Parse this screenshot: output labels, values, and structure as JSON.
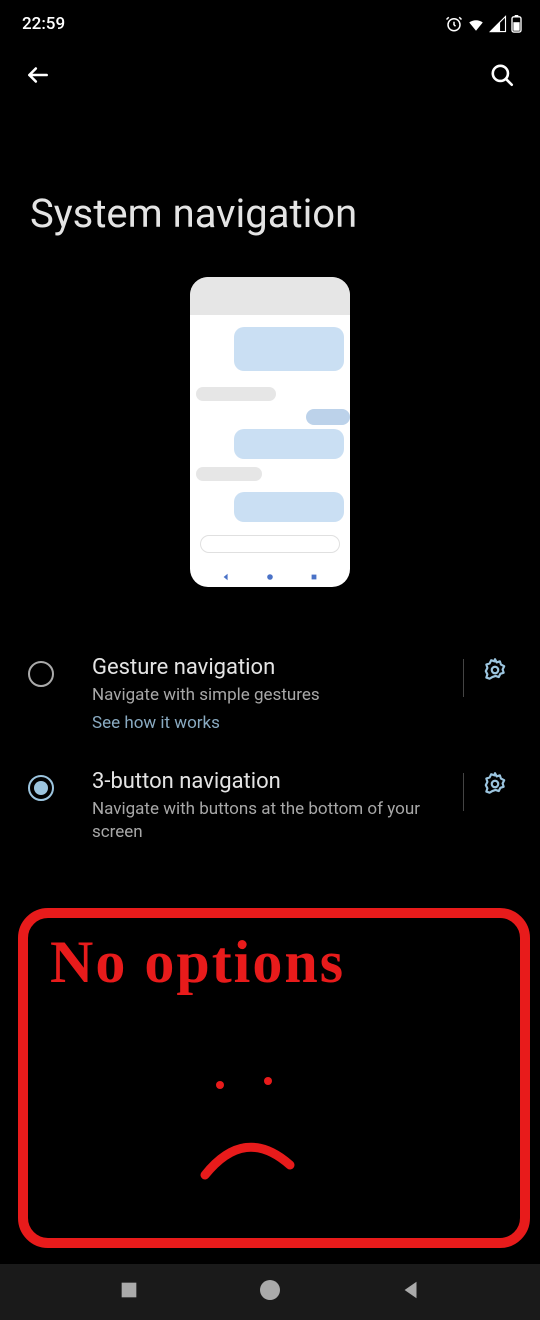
{
  "status": {
    "time": "22:59"
  },
  "header": {
    "title": "System navigation"
  },
  "options": {
    "gesture": {
      "title": "Gesture navigation",
      "desc": "Navigate with simple gestures",
      "link": "See how it works",
      "selected": false
    },
    "three_button": {
      "title": "3-button navigation",
      "desc": "Navigate with buttons at the bottom of your screen",
      "selected": true
    }
  },
  "annotation": {
    "text": "No options"
  }
}
